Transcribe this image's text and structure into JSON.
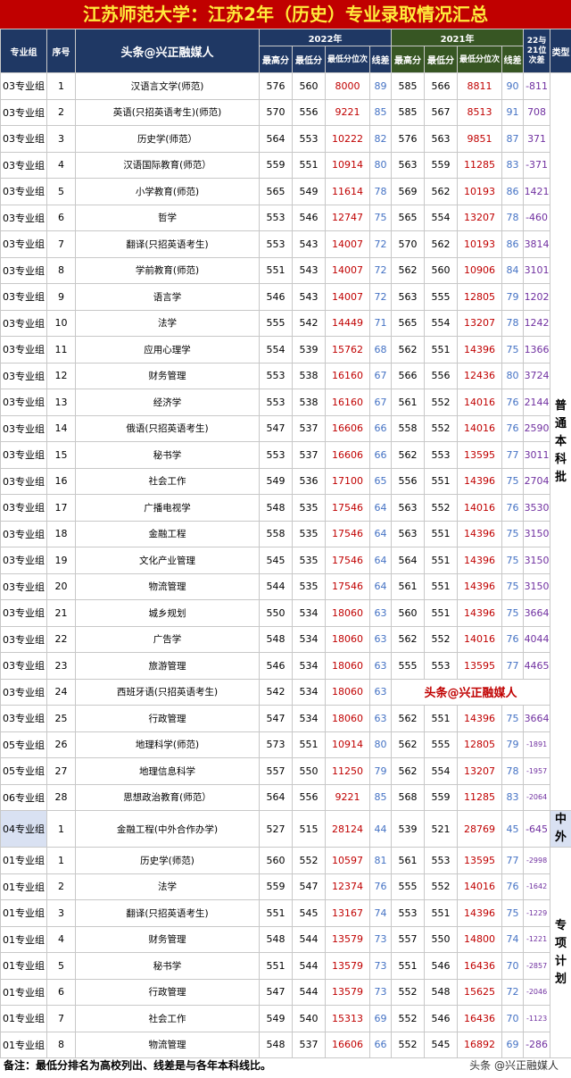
{
  "title": "江苏师范大学：江苏2年（历史）专业录取情况汇总",
  "header": {
    "group": "专业组",
    "seq": "序号",
    "brand": "头条@兴正融媒人",
    "year2022": "2022年",
    "year2021": "2021年",
    "diff": "22与21位次差",
    "type": "类型",
    "max": "最高分",
    "min": "最低分",
    "rank": "最低分位次",
    "line": "线差"
  },
  "rows": [
    {
      "group": "03专业组",
      "seq": "1",
      "major": "汉语言文学(师范)",
      "max22": "576",
      "min22": "560",
      "rank22": "8000",
      "line22": "89",
      "max21": "585",
      "min21": "566",
      "rank21": "8811",
      "line21": "90",
      "diff": "-811"
    },
    {
      "group": "03专业组",
      "seq": "2",
      "major": "英语(只招英语考生)(师范)",
      "max22": "570",
      "min22": "556",
      "rank22": "9221",
      "line22": "85",
      "max21": "585",
      "min21": "567",
      "rank21": "8513",
      "line21": "91",
      "diff": "708"
    },
    {
      "group": "03专业组",
      "seq": "3",
      "major": "历史学(师范）",
      "max22": "564",
      "min22": "553",
      "rank22": "10222",
      "line22": "82",
      "max21": "576",
      "min21": "563",
      "rank21": "9851",
      "line21": "87",
      "diff": "371"
    },
    {
      "group": "03专业组",
      "seq": "4",
      "major": "汉语国际教育(师范）",
      "max22": "559",
      "min22": "551",
      "rank22": "10914",
      "line22": "80",
      "max21": "563",
      "min21": "559",
      "rank21": "11285",
      "line21": "83",
      "diff": "-371"
    },
    {
      "group": "03专业组",
      "seq": "5",
      "major": "小学教育(师范)",
      "max22": "565",
      "min22": "549",
      "rank22": "11614",
      "line22": "78",
      "max21": "569",
      "min21": "562",
      "rank21": "10193",
      "line21": "86",
      "diff": "1421"
    },
    {
      "group": "03专业组",
      "seq": "6",
      "major": "哲学",
      "max22": "553",
      "min22": "546",
      "rank22": "12747",
      "line22": "75",
      "max21": "565",
      "min21": "554",
      "rank21": "13207",
      "line21": "78",
      "diff": "-460"
    },
    {
      "group": "03专业组",
      "seq": "7",
      "major": "翻译(只招英语考生)",
      "max22": "553",
      "min22": "543",
      "rank22": "14007",
      "line22": "72",
      "max21": "570",
      "min21": "562",
      "rank21": "10193",
      "line21": "86",
      "diff": "3814"
    },
    {
      "group": "03专业组",
      "seq": "8",
      "major": "学前教育(师范)",
      "max22": "551",
      "min22": "543",
      "rank22": "14007",
      "line22": "72",
      "max21": "562",
      "min21": "560",
      "rank21": "10906",
      "line21": "84",
      "diff": "3101"
    },
    {
      "group": "03专业组",
      "seq": "9",
      "major": "语言学",
      "max22": "546",
      "min22": "543",
      "rank22": "14007",
      "line22": "72",
      "max21": "563",
      "min21": "555",
      "rank21": "12805",
      "line21": "79",
      "diff": "1202"
    },
    {
      "group": "03专业组",
      "seq": "10",
      "major": "法学",
      "max22": "555",
      "min22": "542",
      "rank22": "14449",
      "line22": "71",
      "max21": "565",
      "min21": "554",
      "rank21": "13207",
      "line21": "78",
      "diff": "1242"
    },
    {
      "group": "03专业组",
      "seq": "11",
      "major": "应用心理学",
      "max22": "554",
      "min22": "539",
      "rank22": "15762",
      "line22": "68",
      "max21": "562",
      "min21": "551",
      "rank21": "14396",
      "line21": "75",
      "diff": "1366"
    },
    {
      "group": "03专业组",
      "seq": "12",
      "major": "财务管理",
      "max22": "553",
      "min22": "538",
      "rank22": "16160",
      "line22": "67",
      "max21": "566",
      "min21": "556",
      "rank21": "12436",
      "line21": "80",
      "diff": "3724"
    },
    {
      "group": "03专业组",
      "seq": "13",
      "major": "经济学",
      "max22": "553",
      "min22": "538",
      "rank22": "16160",
      "line22": "67",
      "max21": "561",
      "min21": "552",
      "rank21": "14016",
      "line21": "76",
      "diff": "2144"
    },
    {
      "group": "03专业组",
      "seq": "14",
      "major": "俄语(只招英语考生)",
      "max22": "547",
      "min22": "537",
      "rank22": "16606",
      "line22": "66",
      "max21": "558",
      "min21": "552",
      "rank21": "14016",
      "line21": "76",
      "diff": "2590"
    },
    {
      "group": "03专业组",
      "seq": "15",
      "major": "秘书学",
      "max22": "553",
      "min22": "537",
      "rank22": "16606",
      "line22": "66",
      "max21": "562",
      "min21": "553",
      "rank21": "13595",
      "line21": "77",
      "diff": "3011"
    },
    {
      "group": "03专业组",
      "seq": "16",
      "major": "社会工作",
      "max22": "549",
      "min22": "536",
      "rank22": "17100",
      "line22": "65",
      "max21": "556",
      "min21": "551",
      "rank21": "14396",
      "line21": "75",
      "diff": "2704"
    },
    {
      "group": "03专业组",
      "seq": "17",
      "major": "广播电视学",
      "max22": "548",
      "min22": "535",
      "rank22": "17546",
      "line22": "64",
      "max21": "563",
      "min21": "552",
      "rank21": "14016",
      "line21": "76",
      "diff": "3530"
    },
    {
      "group": "03专业组",
      "seq": "18",
      "major": "金融工程",
      "max22": "558",
      "min22": "535",
      "rank22": "17546",
      "line22": "64",
      "max21": "563",
      "min21": "551",
      "rank21": "14396",
      "line21": "75",
      "diff": "3150"
    },
    {
      "group": "03专业组",
      "seq": "19",
      "major": "文化产业管理",
      "max22": "545",
      "min22": "535",
      "rank22": "17546",
      "line22": "64",
      "max21": "564",
      "min21": "551",
      "rank21": "14396",
      "line21": "75",
      "diff": "3150"
    },
    {
      "group": "03专业组",
      "seq": "20",
      "major": "物流管理",
      "max22": "544",
      "min22": "535",
      "rank22": "17546",
      "line22": "64",
      "max21": "561",
      "min21": "551",
      "rank21": "14396",
      "line21": "75",
      "diff": "3150"
    },
    {
      "group": "03专业组",
      "seq": "21",
      "major": "城乡规划",
      "max22": "550",
      "min22": "534",
      "rank22": "18060",
      "line22": "63",
      "max21": "560",
      "min21": "551",
      "rank21": "14396",
      "line21": "75",
      "diff": "3664"
    },
    {
      "group": "03专业组",
      "seq": "22",
      "major": "广告学",
      "max22": "548",
      "min22": "534",
      "rank22": "18060",
      "line22": "63",
      "max21": "562",
      "min21": "552",
      "rank21": "14016",
      "line21": "76",
      "diff": "4044"
    },
    {
      "group": "03专业组",
      "seq": "23",
      "major": "旅游管理",
      "max22": "546",
      "min22": "534",
      "rank22": "18060",
      "line22": "63",
      "max21": "555",
      "min21": "553",
      "rank21": "13595",
      "line21": "77",
      "diff": "4465"
    },
    {
      "group": "03专业组",
      "seq": "24",
      "major": "西班牙语(只招英语考生)",
      "max22": "542",
      "min22": "534",
      "rank22": "18060",
      "line22": "63",
      "watermark": "头条@兴正融媒人"
    },
    {
      "group": "03专业组",
      "seq": "25",
      "major": "行政管理",
      "max22": "547",
      "min22": "534",
      "rank22": "18060",
      "line22": "63",
      "max21": "562",
      "min21": "551",
      "rank21": "14396",
      "line21": "75",
      "diff": "3664"
    },
    {
      "group": "05专业组",
      "seq": "26",
      "major": "地理科学(师范)",
      "max22": "573",
      "min22": "551",
      "rank22": "10914",
      "line22": "80",
      "max21": "562",
      "min21": "555",
      "rank21": "12805",
      "line21": "79",
      "diff": "-1891"
    },
    {
      "group": "05专业组",
      "seq": "27",
      "major": "地理信息科学",
      "max22": "557",
      "min22": "550",
      "rank22": "11250",
      "line22": "79",
      "max21": "562",
      "min21": "554",
      "rank21": "13207",
      "line21": "78",
      "diff": "-1957"
    },
    {
      "group": "06专业组",
      "seq": "28",
      "major": "思想政治教育(师范）",
      "max22": "564",
      "min22": "556",
      "rank22": "9221",
      "line22": "85",
      "max21": "568",
      "min21": "559",
      "rank21": "11285",
      "line21": "83",
      "diff": "-2064"
    },
    {
      "group": "04专业组",
      "seq": "1",
      "major": "金融工程(中外合作办学)",
      "max22": "527",
      "min22": "515",
      "rank22": "28124",
      "line22": "44",
      "max21": "539",
      "min21": "521",
      "rank21": "28769",
      "line21": "45",
      "diff": "-645"
    },
    {
      "group": "01专业组",
      "seq": "1",
      "major": "历史学(师范)",
      "max22": "560",
      "min22": "552",
      "rank22": "10597",
      "line22": "81",
      "max21": "561",
      "min21": "553",
      "rank21": "13595",
      "line21": "77",
      "diff": "-2998"
    },
    {
      "group": "01专业组",
      "seq": "2",
      "major": "法学",
      "max22": "559",
      "min22": "547",
      "rank22": "12374",
      "line22": "76",
      "max21": "555",
      "min21": "552",
      "rank21": "14016",
      "line21": "76",
      "diff": "-1642"
    },
    {
      "group": "01专业组",
      "seq": "3",
      "major": "翻译(只招英语考生)",
      "max22": "551",
      "min22": "545",
      "rank22": "13167",
      "line22": "74",
      "max21": "553",
      "min21": "551",
      "rank21": "14396",
      "line21": "75",
      "diff": "-1229"
    },
    {
      "group": "01专业组",
      "seq": "4",
      "major": "财务管理",
      "max22": "548",
      "min22": "544",
      "rank22": "13579",
      "line22": "73",
      "max21": "557",
      "min21": "550",
      "rank21": "14800",
      "line21": "74",
      "diff": "-1221"
    },
    {
      "group": "01专业组",
      "seq": "5",
      "major": "秘书学",
      "max22": "551",
      "min22": "544",
      "rank22": "13579",
      "line22": "73",
      "max21": "551",
      "min21": "546",
      "rank21": "16436",
      "line21": "70",
      "diff": "-2857"
    },
    {
      "group": "01专业组",
      "seq": "6",
      "major": "行政管理",
      "max22": "547",
      "min22": "544",
      "rank22": "13579",
      "line22": "73",
      "max21": "552",
      "min21": "548",
      "rank21": "15625",
      "line21": "72",
      "diff": "-2046"
    },
    {
      "group": "01专业组",
      "seq": "7",
      "major": "社会工作",
      "max22": "549",
      "min22": "540",
      "rank22": "15313",
      "line22": "69",
      "max21": "552",
      "min21": "546",
      "rank21": "16436",
      "line21": "70",
      "diff": "-1123"
    },
    {
      "group": "01专业组",
      "seq": "8",
      "major": "物流管理",
      "max22": "548",
      "min22": "537",
      "rank22": "16606",
      "line22": "66",
      "max21": "552",
      "min21": "545",
      "rank21": "16892",
      "line21": "69",
      "diff": "-286"
    }
  ],
  "types": [
    "普通本科批",
    "中外",
    "专项计划"
  ],
  "footer": {
    "note": "备注：最低分排名为高校列出、线差是与各年本科线比。",
    "watermark": "头条 @兴正融媒人"
  },
  "colors": {
    "title_bg": "#c00000",
    "title_text": "#ffeb3b",
    "header_2022": "#1f3864",
    "header_2021": "#375623",
    "rank": "#c00000",
    "line": "#4472c4",
    "diff": "#7030a0"
  }
}
